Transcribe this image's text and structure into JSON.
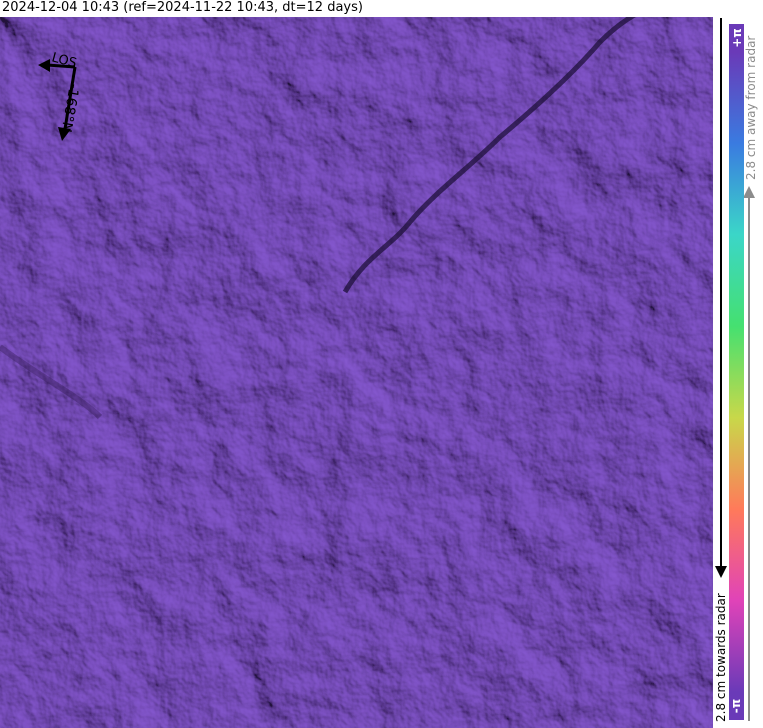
{
  "title": "2024-12-04 10:43 (ref=2024-11-22 10:43, dt=12 days)",
  "map": {
    "base_color": "#6a3ab8",
    "los_label": "LOS",
    "heading_label": "-168°N"
  },
  "colorbar": {
    "top_label": "+π",
    "bottom_label": "-π",
    "top_color": "#6a3ab8",
    "bottom_color": "#6a3ab8",
    "ramp": [
      "#6a3ab8",
      "#3a7be0",
      "#3bd6c8",
      "#45e070",
      "#c8d84a",
      "#ff7a5a",
      "#e043b8",
      "#6a3ab8"
    ],
    "away_label": "2.8 cm away from radar",
    "towards_label": "2.8 cm towards radar"
  }
}
